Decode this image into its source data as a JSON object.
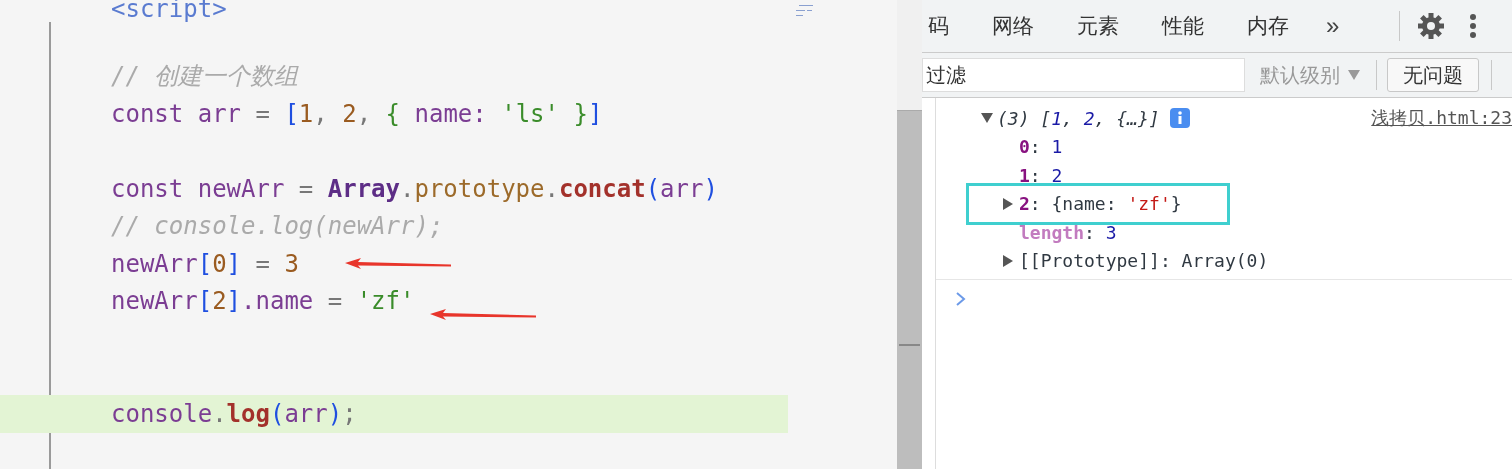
{
  "editor": {
    "lines": [
      {
        "kind": "code",
        "highlighted": false,
        "tokens": [
          {
            "text": "<script>",
            "kind": "tag"
          }
        ]
      },
      {
        "kind": "blank",
        "highlighted": false
      },
      {
        "kind": "code",
        "highlighted": false,
        "tokens": [
          {
            "text": "// 创建一个数组",
            "kind": "comment"
          }
        ]
      },
      {
        "kind": "code",
        "highlighted": false,
        "tokens": [
          {
            "text": "const",
            "kind": "kw"
          },
          {
            "text": " arr ",
            "kind": "ident"
          },
          {
            "text": "= ",
            "kind": "op"
          },
          {
            "text": "[",
            "kind": "bracket"
          },
          {
            "text": "1",
            "kind": "num"
          },
          {
            "text": ", ",
            "kind": "op"
          },
          {
            "text": "2",
            "kind": "num"
          },
          {
            "text": ", ",
            "kind": "op"
          },
          {
            "text": "{",
            "kind": "brace"
          },
          {
            "text": " name: ",
            "kind": "ident"
          },
          {
            "text": "'ls'",
            "kind": "str"
          },
          {
            "text": " }",
            "kind": "brace"
          },
          {
            "text": "]",
            "kind": "bracket"
          }
        ]
      },
      {
        "kind": "blank",
        "highlighted": false
      },
      {
        "kind": "code",
        "highlighted": false,
        "tokens": [
          {
            "text": "const",
            "kind": "kw"
          },
          {
            "text": " newArr ",
            "kind": "ident"
          },
          {
            "text": "= ",
            "kind": "op"
          },
          {
            "text": "Array",
            "kind": "cls"
          },
          {
            "text": ".",
            "kind": "op"
          },
          {
            "text": "prototype",
            "kind": "prop"
          },
          {
            "text": ".",
            "kind": "op"
          },
          {
            "text": "concat",
            "kind": "method"
          },
          {
            "text": "(",
            "kind": "bracket"
          },
          {
            "text": "arr",
            "kind": "ident"
          },
          {
            "text": ")",
            "kind": "bracket"
          }
        ]
      },
      {
        "kind": "code",
        "highlighted": false,
        "tokens": [
          {
            "text": "// console.log(newArr);",
            "kind": "comment"
          }
        ]
      },
      {
        "kind": "code",
        "highlighted": false,
        "arrow_mark": true,
        "tokens": [
          {
            "text": "newArr",
            "kind": "ident"
          },
          {
            "text": "[",
            "kind": "bracket"
          },
          {
            "text": "0",
            "kind": "num"
          },
          {
            "text": "]",
            "kind": "bracket"
          },
          {
            "text": " = ",
            "kind": "op"
          },
          {
            "text": "3",
            "kind": "num"
          }
        ]
      },
      {
        "kind": "code",
        "highlighted": false,
        "arrow_mark": true,
        "tokens": [
          {
            "text": "newArr",
            "kind": "ident"
          },
          {
            "text": "[",
            "kind": "bracket"
          },
          {
            "text": "2",
            "kind": "num"
          },
          {
            "text": "]",
            "kind": "bracket"
          },
          {
            "text": ".name",
            "kind": "ident"
          },
          {
            "text": " = ",
            "kind": "op"
          },
          {
            "text": "'zf'",
            "kind": "str"
          }
        ]
      },
      {
        "kind": "blank",
        "highlighted": false
      },
      {
        "kind": "blank",
        "highlighted": false
      },
      {
        "kind": "code",
        "highlighted": true,
        "tokens": [
          {
            "text": "console",
            "kind": "ident"
          },
          {
            "text": ".",
            "kind": "op"
          },
          {
            "text": "log",
            "kind": "method"
          },
          {
            "text": "(",
            "kind": "bracket"
          },
          {
            "text": "arr",
            "kind": "ident"
          },
          {
            "text": ")",
            "kind": "bracket"
          },
          {
            "text": ";",
            "kind": "op"
          }
        ]
      }
    ]
  },
  "devtools": {
    "tabs": [
      {
        "label": "码"
      },
      {
        "label": "网络"
      },
      {
        "label": "元素"
      },
      {
        "label": "性能"
      },
      {
        "label": "内存"
      }
    ],
    "more_tabs": "»",
    "filter": {
      "placeholder": "过滤"
    },
    "level_dropdown": "默认级别",
    "issues_button": "无问题",
    "console": {
      "entries": [
        {
          "expanded": true,
          "source": "浅拷贝.html:23",
          "tokens": [
            {
              "text": "(3) [",
              "kind": "plain"
            },
            {
              "text": "1",
              "kind": "num"
            },
            {
              "text": ", ",
              "kind": "plain"
            },
            {
              "text": "2",
              "kind": "num"
            },
            {
              "text": ", {…}]",
              "kind": "plain"
            }
          ],
          "children": [
            {
              "expandable": false,
              "boxed": false,
              "tokens": [
                {
                  "text": "0",
                  "kind": "key"
                },
                {
                  "text": ": ",
                  "kind": "plain"
                },
                {
                  "text": "1",
                  "kind": "num"
                }
              ]
            },
            {
              "expandable": false,
              "boxed": false,
              "tokens": [
                {
                  "text": "1",
                  "kind": "key"
                },
                {
                  "text": ": ",
                  "kind": "plain"
                },
                {
                  "text": "2",
                  "kind": "num"
                }
              ]
            },
            {
              "expandable": true,
              "boxed": true,
              "tokens": [
                {
                  "text": "2",
                  "kind": "key"
                },
                {
                  "text": ": {name: ",
                  "kind": "plain"
                },
                {
                  "text": "'zf'",
                  "kind": "str"
                },
                {
                  "text": "}",
                  "kind": "plain"
                }
              ]
            },
            {
              "expandable": false,
              "boxed": false,
              "tokens": [
                {
                  "text": "length",
                  "kind": "meta"
                },
                {
                  "text": ": ",
                  "kind": "plain"
                },
                {
                  "text": "3",
                  "kind": "num"
                }
              ]
            },
            {
              "expandable": true,
              "boxed": false,
              "tokens": [
                {
                  "text": "[[Prototype]]: Array(0)",
                  "kind": "plain"
                }
              ]
            }
          ]
        }
      ]
    }
  }
}
